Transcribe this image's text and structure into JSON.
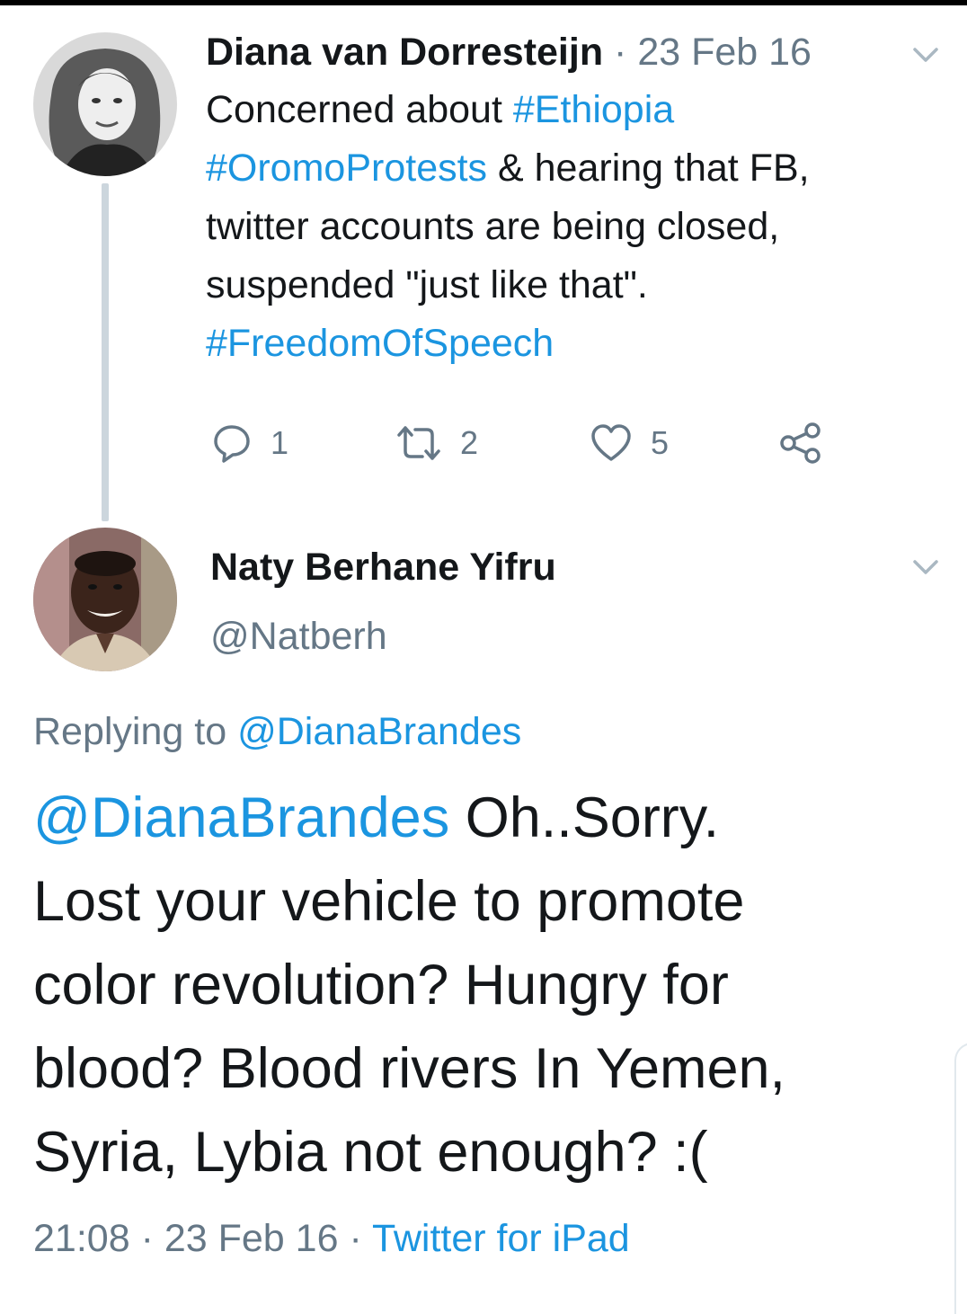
{
  "colors": {
    "link": "#1b95e0",
    "secondary_text": "#657786",
    "primary_text": "#14171a",
    "thread_line": "#ccd6dd"
  },
  "tweet1": {
    "author_name": "Diana van Dorresteijn",
    "separator": "·",
    "date": "23 Feb 16",
    "menu_icon": "chevron-down-icon",
    "body_lines": [
      [
        {
          "text": "Concerned about "
        },
        {
          "text": "#Ethiopia",
          "link": true
        }
      ],
      [
        {
          "text": "#OromoProtests",
          "link": true
        },
        {
          "text": " & hearing that FB,"
        }
      ],
      [
        {
          "text": "twitter accounts are being closed,"
        }
      ],
      [
        {
          "text": "suspended \"just like that\"."
        }
      ],
      [
        {
          "text": "#FreedomOfSpeech",
          "link": true
        }
      ]
    ],
    "actions": {
      "reply_count": "1",
      "retweet_count": "2",
      "like_count": "5",
      "reply_icon": "reply-icon",
      "retweet_icon": "retweet-icon",
      "like_icon": "heart-icon",
      "share_icon": "share-icon"
    }
  },
  "tweet2": {
    "author_name": "Naty Berhane Yifru",
    "handle": "@Natberh",
    "menu_icon": "chevron-down-icon",
    "replying_prefix": "Replying to ",
    "replying_to": "@DianaBrandes",
    "body_lines": [
      [
        {
          "text": "@DianaBrandes",
          "link": true
        },
        {
          "text": " Oh..Sorry."
        }
      ],
      [
        {
          "text": "Lost your vehicle to promote"
        }
      ],
      [
        {
          "text": "color revolution? Hungry for"
        }
      ],
      [
        {
          "text": "blood? Blood rivers In Yemen,"
        }
      ],
      [
        {
          "text": "Syria, Lybia not enough? :("
        }
      ]
    ],
    "time": "21:08",
    "separator": "·",
    "date": "23 Feb 16",
    "source": "Twitter for iPad"
  }
}
